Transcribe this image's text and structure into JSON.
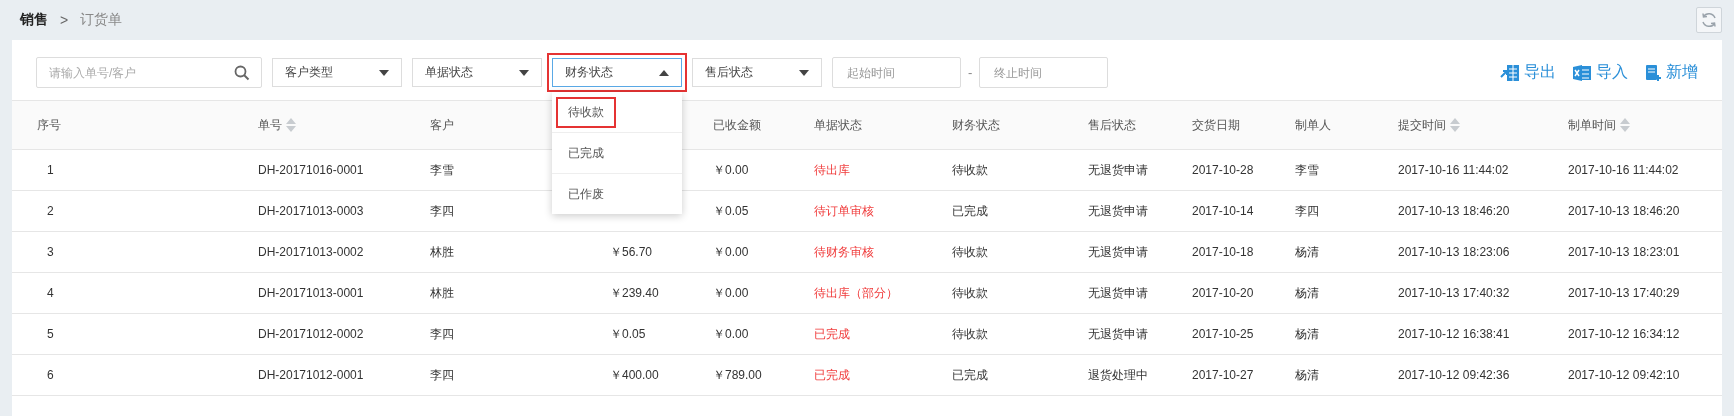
{
  "breadcrumb": {
    "parent": "销售",
    "separator": ">",
    "current": "订货单"
  },
  "filters": {
    "search": {
      "placeholder": "请输入单号/客户"
    },
    "selects": [
      {
        "label": "客户类型",
        "expanded": false,
        "highlighted": false
      },
      {
        "label": "单据状态",
        "expanded": false,
        "highlighted": false
      },
      {
        "label": "财务状态",
        "expanded": true,
        "highlighted": true,
        "options": [
          {
            "label": "待收款",
            "highlighted": true
          },
          {
            "label": "已完成",
            "highlighted": false
          },
          {
            "label": "已作废",
            "highlighted": false
          }
        ]
      },
      {
        "label": "售后状态",
        "expanded": false,
        "highlighted": false
      }
    ],
    "date_start": {
      "placeholder": "起始时间"
    },
    "date_separator": "-",
    "date_end": {
      "placeholder": "终止时间"
    }
  },
  "actions": [
    {
      "kind": "export",
      "label": "导出"
    },
    {
      "kind": "import",
      "label": "导入"
    },
    {
      "kind": "add",
      "label": "新增"
    }
  ],
  "table": {
    "columns": [
      {
        "label": "序号",
        "sortable": false
      },
      {
        "label": "单号",
        "sortable": true
      },
      {
        "label": "客户",
        "sortable": false
      },
      null,
      {
        "label": "已收金额",
        "sortable": false
      },
      {
        "label": "单据状态",
        "sortable": false
      },
      {
        "label": "财务状态",
        "sortable": false
      },
      {
        "label": "售后状态",
        "sortable": false
      },
      {
        "label": "交货日期",
        "sortable": false
      },
      {
        "label": "制单人",
        "sortable": false
      },
      {
        "label": "提交时间",
        "sortable": true
      },
      {
        "label": "制单时间",
        "sortable": true
      }
    ],
    "rows": [
      [
        "1",
        "DH-20171016-0001",
        "李雪",
        "",
        "￥0.00",
        "待出库",
        "待收款",
        "无退货申请",
        "2017-10-28",
        "李雪",
        "2017-10-16 11:44:02",
        "2017-10-16 11:44:02"
      ],
      [
        "2",
        "DH-20171013-0003",
        "李四",
        "",
        "￥0.05",
        "待订单审核",
        "已完成",
        "无退货申请",
        "2017-10-14",
        "李四",
        "2017-10-13 18:46:20",
        "2017-10-13 18:46:20"
      ],
      [
        "3",
        "DH-20171013-0002",
        "林胜",
        "￥56.70",
        "￥0.00",
        "待财务审核",
        "待收款",
        "无退货申请",
        "2017-10-18",
        "杨清",
        "2017-10-13 18:23:06",
        "2017-10-13 18:23:01"
      ],
      [
        "4",
        "DH-20171013-0001",
        "林胜",
        "￥239.40",
        "￥0.00",
        "待出库（部分）",
        "待收款",
        "无退货申请",
        "2017-10-20",
        "杨清",
        "2017-10-13 17:40:32",
        "2017-10-13 17:40:29"
      ],
      [
        "5",
        "DH-20171012-0002",
        "李四",
        "￥0.05",
        "￥0.00",
        "已完成",
        "待收款",
        "无退货申请",
        "2017-10-25",
        "杨清",
        "2017-10-12 16:38:41",
        "2017-10-12 16:34:12"
      ],
      [
        "6",
        "DH-20171012-0001",
        "李四",
        "￥400.00",
        "￥789.00",
        "已完成",
        "已完成",
        "退货处理中",
        "2017-10-27",
        "杨清",
        "2017-10-12 09:42:36",
        "2017-10-12 09:42:10"
      ]
    ]
  }
}
